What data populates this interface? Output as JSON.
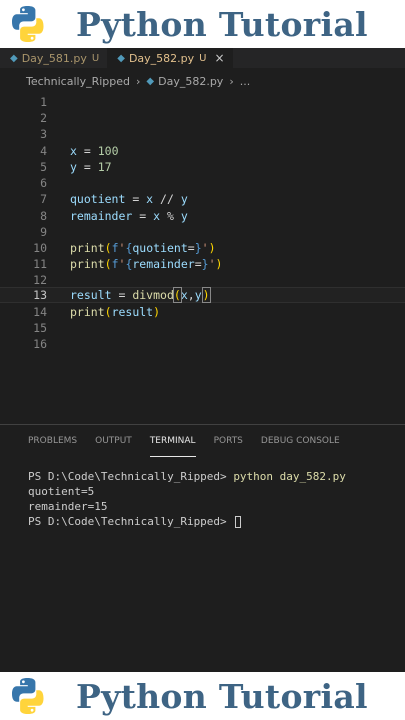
{
  "banner": {
    "title": "Python Tutorial"
  },
  "tabs": [
    {
      "label": "Day_581.py",
      "modified": "U"
    },
    {
      "label": "Day_582.py",
      "modified": "U",
      "close": "×"
    }
  ],
  "breadcrumb": {
    "folder": "Technically_Ripped",
    "file": "Day_582.py",
    "more": "..."
  },
  "editor": {
    "line_numbers": [
      "1",
      "2",
      "3",
      "4",
      "5",
      "6",
      "7",
      "8",
      "9",
      "10",
      "11",
      "12",
      "13",
      "14",
      "15",
      "16"
    ],
    "current_line": 13,
    "code": {
      "l4_var": "x",
      "l4_op": " = ",
      "l4_val": "100",
      "l5_var": "y",
      "l5_op": " = ",
      "l5_val": "17",
      "l7_var": "quotient",
      "l7_op": " = ",
      "l7_a": "x",
      "l7_mid": " // ",
      "l7_b": "y",
      "l8_var": "remainder",
      "l8_op": " = ",
      "l8_a": "x",
      "l8_mid": " % ",
      "l8_b": "y",
      "l10_fn": "print",
      "l10_open": "(",
      "l10_f": "f",
      "l10_s1": "'",
      "l10_b1": "{",
      "l10_var": "quotient",
      "l10_eq": "=",
      "l10_b2": "}",
      "l10_s2": "'",
      "l10_close": ")",
      "l11_fn": "print",
      "l11_open": "(",
      "l11_f": "f",
      "l11_s1": "'",
      "l11_b1": "{",
      "l11_var": "remainder",
      "l11_eq": "=",
      "l11_b2": "}",
      "l11_s2": "'",
      "l11_close": ")",
      "l13_var": "result",
      "l13_op": " = ",
      "l13_fn": "divmod",
      "l13_open": "(",
      "l13_a": "x",
      "l13_comma": ",",
      "l13_b": "y",
      "l13_close": ")",
      "l14_fn": "print",
      "l14_open": "(",
      "l14_var": "result",
      "l14_close": ")"
    }
  },
  "panel": {
    "tabs": [
      "PROBLEMS",
      "OUTPUT",
      "TERMINAL",
      "PORTS",
      "DEBUG CONSOLE"
    ],
    "active_tab": "TERMINAL"
  },
  "terminal": {
    "prompt1": "PS D:\\Code\\Technically_Ripped> ",
    "command": "python day_582.py",
    "out1": "quotient=5",
    "out2": "remainder=15",
    "prompt2": "PS D:\\Code\\Technically_Ripped> "
  },
  "colors": {
    "banner_text": "#3e6484",
    "python_blue": "#3776ab",
    "python_yellow": "#ffd43b"
  }
}
